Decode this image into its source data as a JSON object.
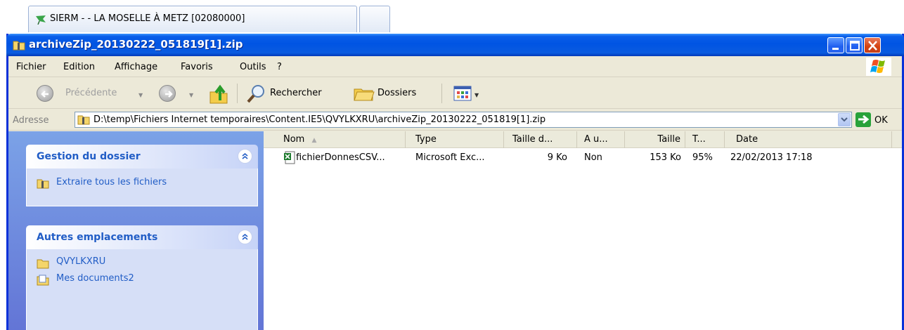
{
  "tab": {
    "label": "SIERM - - LA MOSELLE À METZ [02080000]",
    "icon": "flag-icon"
  },
  "window": {
    "title": "archiveZip_20130222_051819[1].zip",
    "icon": "zip-folder-icon"
  },
  "menubar": {
    "items": [
      "Fichier",
      "Edition",
      "Affichage",
      "Favoris",
      "Outils",
      "?"
    ]
  },
  "toolbar": {
    "back_label": "Précédente",
    "search_label": "Rechercher",
    "folders_label": "Dossiers"
  },
  "address": {
    "label": "Adresse",
    "path": "D:\\temp\\Fichiers Internet temporaires\\Content.IE5\\QVYLKXRU\\archiveZip_20130222_051819[1].zip",
    "go_label": "OK"
  },
  "left_pane": {
    "box1": {
      "title": "Gestion du dossier",
      "links": [
        "Extraire tous les fichiers"
      ]
    },
    "box2": {
      "title": "Autres emplacements",
      "links": [
        "QVYLKXRU",
        "Mes documents2"
      ]
    }
  },
  "list": {
    "columns": [
      "Nom",
      "Type",
      "Taille d...",
      "A u...",
      "Taille",
      "T...",
      "Date"
    ],
    "rows": [
      [
        "fichierDonnesCSV...",
        "Microsoft Exc...",
        "9 Ko",
        "Non",
        "153 Ko",
        "95%",
        "22/02/2013 17:18"
      ]
    ]
  }
}
